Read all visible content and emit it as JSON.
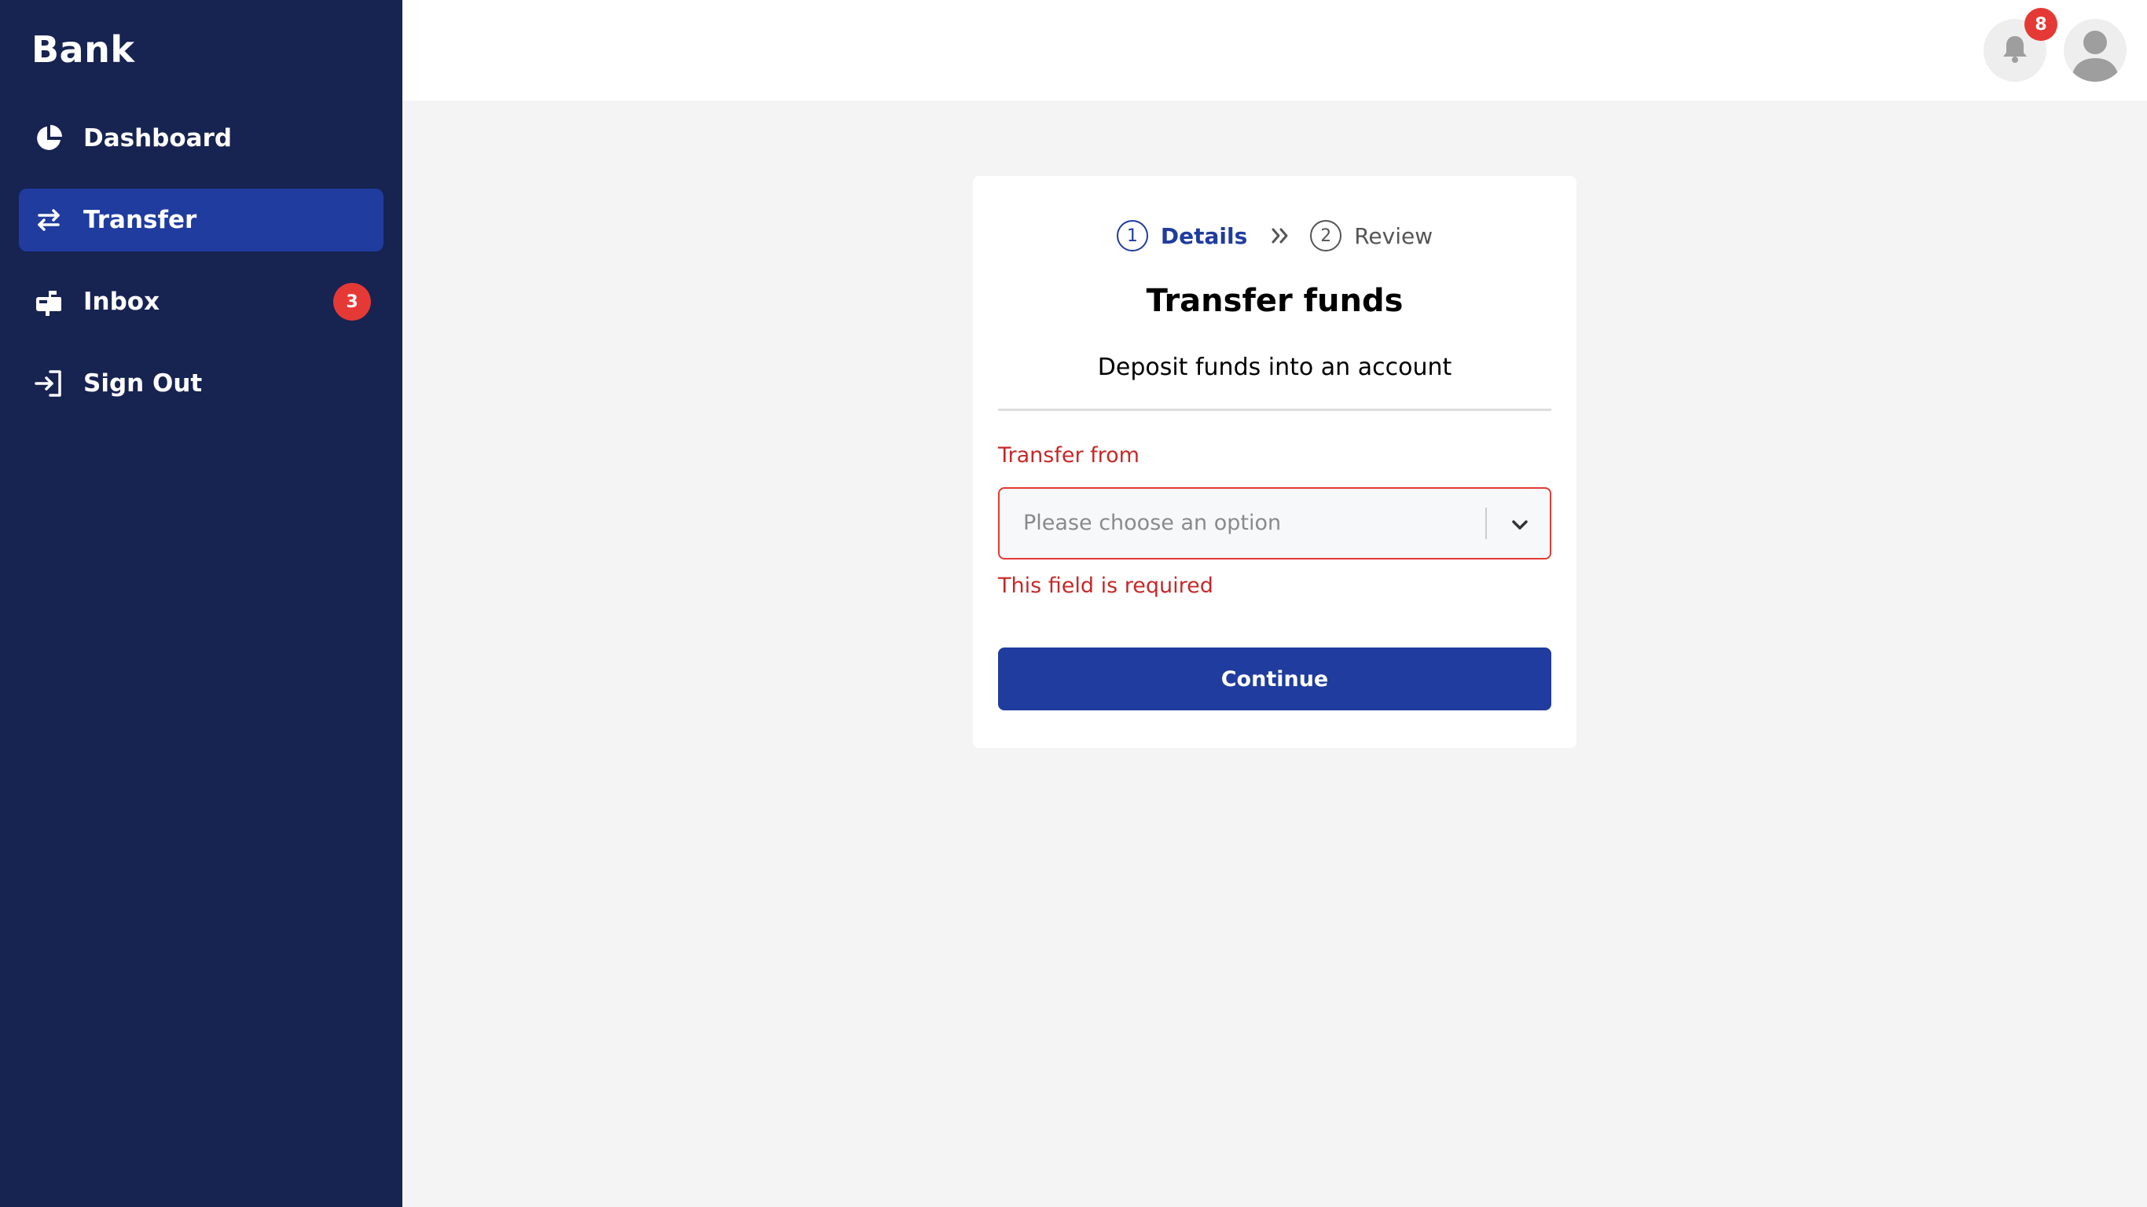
{
  "app": {
    "brand": "Bank"
  },
  "sidebar": {
    "items": [
      {
        "label": "Dashboard",
        "icon": "pie-chart-icon",
        "active": false
      },
      {
        "label": "Transfer",
        "icon": "transfer-arrows-icon",
        "active": true
      },
      {
        "label": "Inbox",
        "icon": "mailbox-icon",
        "active": false,
        "badge": "3"
      },
      {
        "label": "Sign Out",
        "icon": "sign-out-icon",
        "active": false
      }
    ]
  },
  "topbar": {
    "notifications_count": "8",
    "notification_icon": "bell-icon",
    "avatar_icon": "user-avatar-icon"
  },
  "stepper": {
    "steps": [
      {
        "number": "1",
        "label": "Details",
        "state": "current"
      },
      {
        "number": "2",
        "label": "Review",
        "state": "upcoming"
      }
    ]
  },
  "card": {
    "title": "Transfer funds",
    "subtitle": "Deposit funds into an account"
  },
  "form": {
    "transfer_from": {
      "label": "Transfer from",
      "placeholder": "Please choose an option",
      "value": "",
      "error": "This field is required"
    },
    "submit_label": "Continue"
  },
  "colors": {
    "sidebar_bg": "#172350",
    "accent": "#1f3c9e",
    "error": "#c62828",
    "badge": "#e53935",
    "page_bg": "#f4f4f4"
  }
}
